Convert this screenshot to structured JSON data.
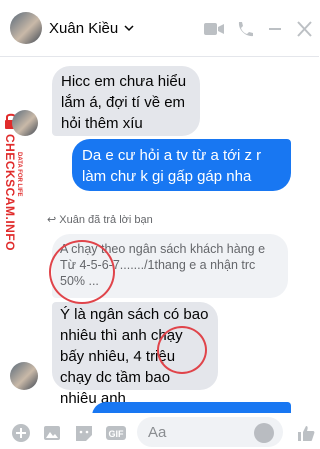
{
  "header": {
    "contact_name": "Xuân Kiều"
  },
  "watermark": {
    "site": "CHECKSCAM.INFO",
    "tag": "DATA FOR LIFE"
  },
  "messages": [
    {
      "dir": "in",
      "text": "Hicc em chưa hiểu lắm á, đợi tí về em hỏi thêm xíu"
    },
    {
      "dir": "out",
      "text": "Da e cư hỏi a tv từ a tới z r làm chư k gi gấp gáp nha"
    }
  ],
  "reply": {
    "note": "Xuân đã trả lời bạn",
    "quoted": "A chạy theo ngân sách khách hàng e Từ 4-5-6-7......./1thang e a nhận trc 50% ...",
    "text": "Ý là ngân sách có bao nhiêu thì anh chạy bấy nhiêu, 4 triệu chạy dc tầm bao nhiêu anh"
  },
  "composer": {
    "placeholder": "Aa"
  },
  "colors": {
    "accent": "#1877f2",
    "incoming": "#e4e6eb",
    "circle": "#e0444a"
  }
}
